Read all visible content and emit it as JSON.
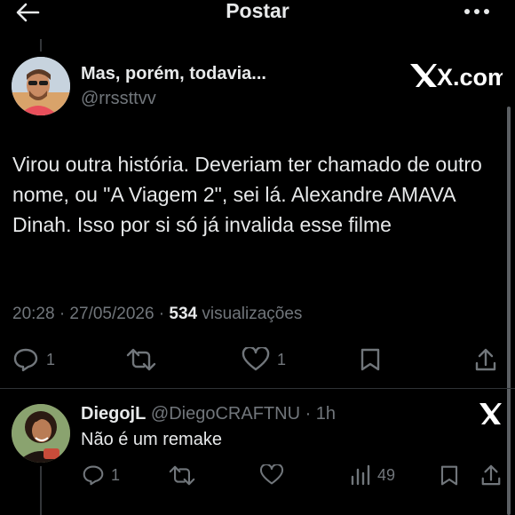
{
  "header": {
    "title": "Postar"
  },
  "tweet": {
    "author_name": "Mas, porém, todavia...",
    "author_handle": "@rrssttvv",
    "brand": "X.com",
    "text": "Virou outra história. Deveriam ter chamado de outro nome, ou \"A Viagem 2\", sei lá. Alexandre AMAVA Dinah. Isso por si só já invalida esse filme",
    "time": "20:28 · 27/05/2026 · ",
    "views": "534",
    "views_label": " visualizações",
    "reply_count": "1",
    "like_count": "1"
  },
  "reply": {
    "author_name": "DiegojL",
    "author_handle": "@DiegoCRAFTNU",
    "separator": " · ",
    "time": "1h",
    "text": "Não é um remake",
    "reply_count": "1",
    "views_count": "49"
  },
  "icons": {
    "back": "arrow-left-icon",
    "more": "more-horizontal-icon",
    "reply": "reply-bubble-icon",
    "retweet": "retweet-icon",
    "like": "heart-icon",
    "bookmark": "bookmark-icon",
    "share": "share-icon",
    "views": "views-bar-icon",
    "x_logo": "x-logo-icon"
  },
  "colors": {
    "background": "#000000",
    "text": "#e7e9ea",
    "muted": "#71767b",
    "divider": "#2f3336"
  }
}
